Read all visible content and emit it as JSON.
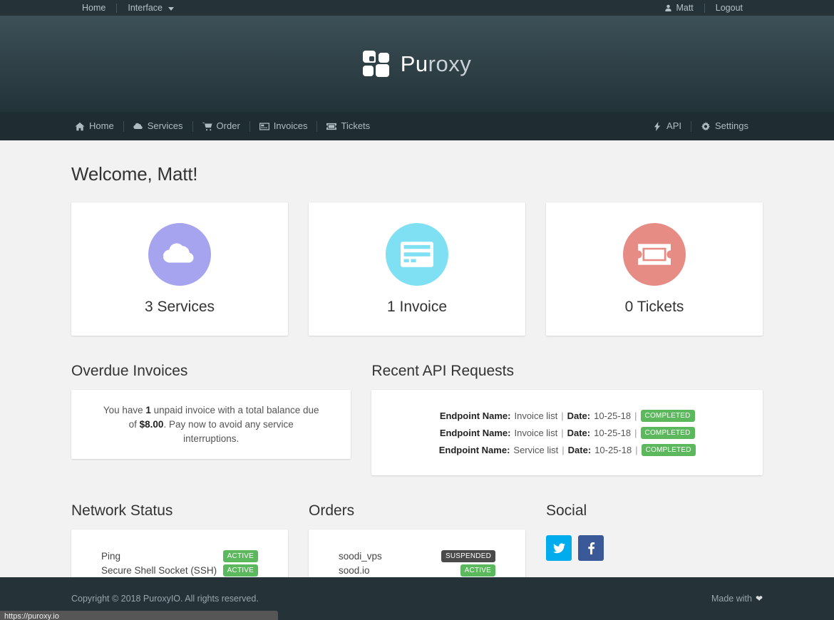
{
  "topbar": {
    "left_links": [
      {
        "label": "Home",
        "icon": "none"
      },
      {
        "label": "Interface",
        "icon": "chevron-down-icon"
      }
    ],
    "user": "Matt",
    "user_icon": "user-icon",
    "logout": "Logout"
  },
  "banner": {
    "logo_text_strong": "Pu",
    "logo_text_dim": "roxy",
    "logo_icon": "puroxy-logo-icon"
  },
  "mainnav": {
    "left": [
      {
        "label": "Home",
        "icon": "home-icon"
      },
      {
        "label": "Services",
        "icon": "cloud-icon"
      },
      {
        "label": "Order",
        "icon": "cart-icon"
      },
      {
        "label": "Invoices",
        "icon": "invoice-icon"
      },
      {
        "label": "Tickets",
        "icon": "ticket-icon"
      }
    ],
    "right": [
      {
        "label": "API",
        "icon": "bolt-icon"
      },
      {
        "label": "Settings",
        "icon": "gear-icon"
      }
    ]
  },
  "main": {
    "page_title": "Welcome, Matt!",
    "stat_cards": [
      {
        "label": "3 Services",
        "icon": "cloud-icon",
        "color": "#a6a4ef"
      },
      {
        "label": "1 Invoice",
        "icon": "credit-card-icon",
        "color": "#7ee0f2"
      },
      {
        "label": "0 Tickets",
        "icon": "ticket-icon",
        "color": "#e78b85"
      }
    ],
    "overdue": {
      "heading": "Overdue Invoices",
      "text_1": "You have ",
      "count": "1",
      "text_2": " unpaid invoice with a total balance due of ",
      "amount": "$8.00",
      "text_3": ". Pay now to avoid any service interruptions."
    },
    "api_requests": {
      "heading": "Recent API Requests",
      "endpoint_label": "Endpoint Name:",
      "date_label": "Date:",
      "separator": "|",
      "rows": [
        {
          "endpoint": "Invoice list",
          "date": "10-25-18",
          "status": "COMPLETED"
        },
        {
          "endpoint": "Invoice list",
          "date": "10-25-18",
          "status": "COMPLETED"
        },
        {
          "endpoint": "Service list",
          "date": "10-25-18",
          "status": "COMPLETED"
        }
      ]
    },
    "network_status": {
      "heading": "Network Status",
      "rows": [
        {
          "name": "Ping",
          "status": "ACTIVE",
          "status_type": "green"
        },
        {
          "name": "Secure Shell Socket (SSH)",
          "status": "ACTIVE",
          "status_type": "green"
        }
      ]
    },
    "orders": {
      "heading": "Orders",
      "rows": [
        {
          "name": "soodi_vps",
          "status": "SUSPENDED",
          "status_type": "gray"
        },
        {
          "name": "sood.io",
          "status": "ACTIVE",
          "status_type": "green"
        }
      ]
    },
    "social": {
      "heading": "Social",
      "buttons": [
        {
          "name": "twitter",
          "icon": "twitter-icon",
          "color": "#00aced"
        },
        {
          "name": "facebook",
          "icon": "facebook-icon",
          "color": "#3b5998"
        }
      ]
    }
  },
  "footer": {
    "copyright": "Copyright © 2018 PuroxyIO. All rights reserved.",
    "made_with": "Made with",
    "heart_icon": "heart-icon"
  },
  "status_tip": {
    "url": "https://puroxy.io"
  }
}
